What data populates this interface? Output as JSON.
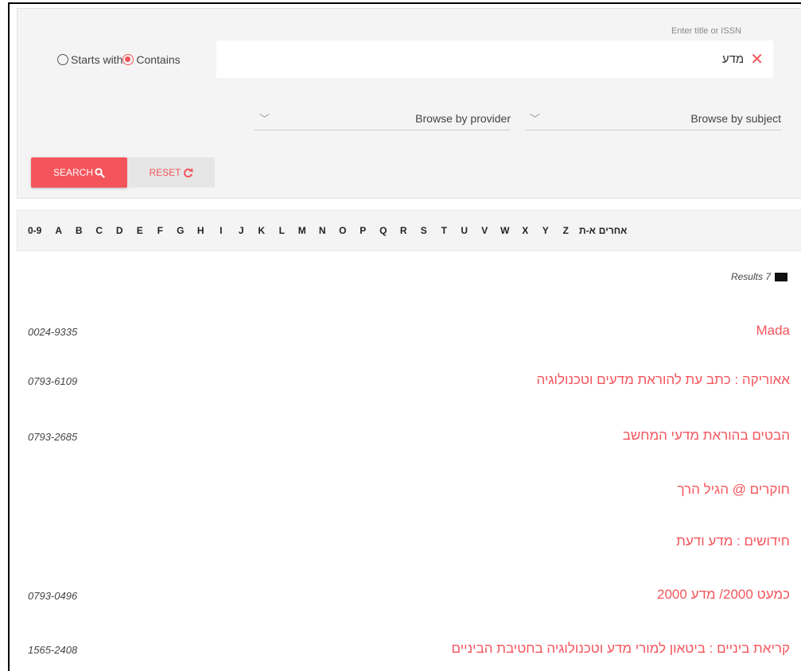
{
  "search": {
    "hint": "Enter title or ISSN",
    "query": "מדע",
    "radio_starts": "Starts with",
    "radio_contains": "Contains",
    "selected_mode": "Contains",
    "browse_provider": "Browse by provider",
    "browse_subject": "Browse by subject",
    "search_label": "SEARCH",
    "reset_label": "RESET"
  },
  "alphabet": [
    "0-9",
    "A",
    "B",
    "C",
    "D",
    "E",
    "F",
    "G",
    "H",
    "I",
    "J",
    "K",
    "L",
    "M",
    "N",
    "O",
    "P",
    "Q",
    "R",
    "S",
    "T",
    "U",
    "V",
    "W",
    "X",
    "Y",
    "Z",
    "א-ת",
    "אחרים"
  ],
  "results": {
    "count_label": "Results 7",
    "items": [
      {
        "title": "Mada",
        "issn": "0024-9335"
      },
      {
        "title": "אאוריקה : כתב עת להוראת מדעים וטכנולוגיה",
        "issn": "0793-6109"
      },
      {
        "title": "הבטים בהוראת מדעי המחשב",
        "issn": "0793-2685"
      },
      {
        "title": "חוקרים @ הגיל הרך",
        "issn": ""
      },
      {
        "title": "חידושים : מדע ודעת",
        "issn": ""
      },
      {
        "title": "כמעט 2000/ מדע 2000",
        "issn": "0793-0496"
      },
      {
        "title": "קריאת ביניים : ביטאון למורי מדע וטכנולוגיה בחטיבת הביניים",
        "issn": "1565-2408"
      }
    ]
  },
  "colors": {
    "accent": "#f4555c",
    "panel": "#f4f4f4"
  }
}
